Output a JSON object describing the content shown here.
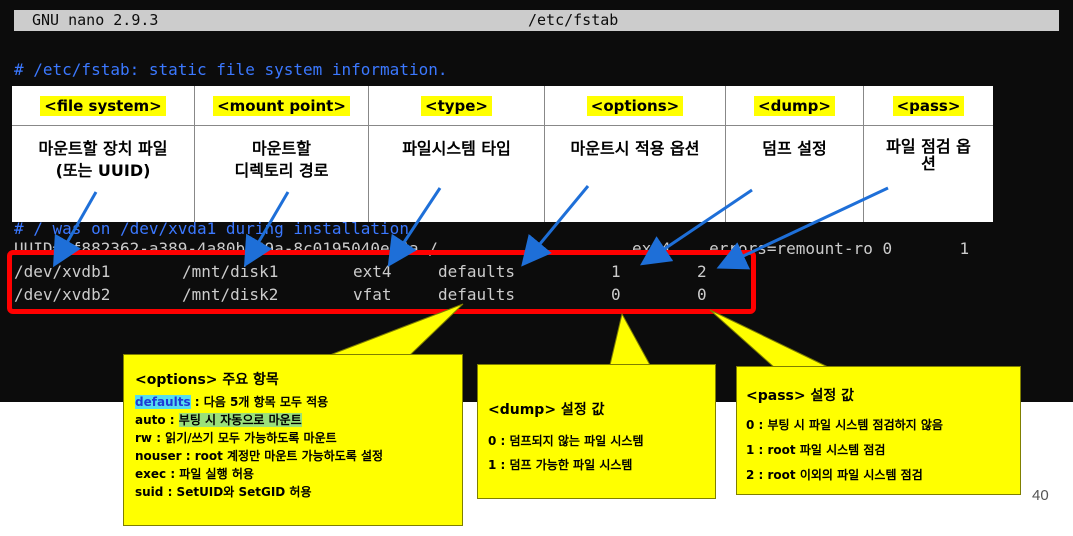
{
  "titlebar": {
    "app": "GNU nano 2.9.3",
    "file": "/etc/fstab"
  },
  "comment_line": "# /etc/fstab: static file system information.",
  "hidden_comment": "# / was on /dev/xvda1 during installation",
  "uuid_line": "UUID=8f882362-a389-4a80bb69a-8c0195040e44a /",
  "uuid_line_tail": "ext4    errors=remount-ro 0       1",
  "rows": [
    {
      "device": "/dev/xvdb1",
      "mount": "/mnt/disk1",
      "type": "ext4",
      "options": "defaults",
      "dump": "1",
      "pass": "2"
    },
    {
      "device": "/dev/xvdb2",
      "mount": "/mnt/disk2",
      "type": "vfat",
      "options": "defaults",
      "dump": "0",
      "pass": "0"
    }
  ],
  "table": {
    "headers": [
      "<file system>",
      "<mount point>",
      "<type>",
      "<options>",
      "<dump>",
      "<pass>"
    ],
    "desc": [
      [
        "마운트할 장치 파일",
        "(또는 UUID)"
      ],
      [
        "마운트할",
        "디렉토리 경로"
      ],
      [
        "파일시스템 타입"
      ],
      [
        "마운트시 적용 옵션"
      ],
      [
        "덤프 설정"
      ],
      [
        "파일 점검 옵",
        "션"
      ]
    ]
  },
  "callout_options": {
    "title": "<options> 주요 항목",
    "lines": [
      {
        "key": "defaults",
        "sep": " : ",
        "text": "다음 5개 항목 모두 적용"
      },
      {
        "key": "auto",
        "sep": " : ",
        "text": "부팅 시 자동으로 마운트"
      },
      {
        "key": "rw",
        "sep": " : ",
        "text": "읽기/쓰기 모두 가능하도록 마운트"
      },
      {
        "key": "nouser",
        "sep": " : ",
        "text": "root 계정만 마운트 가능하도록 설정"
      },
      {
        "key": "exec",
        "sep": " : ",
        "text": "파일 실행 허용"
      },
      {
        "key": "suid",
        "sep": " : ",
        "text": "SetUID와 SetGID 허용"
      }
    ]
  },
  "callout_dump": {
    "title": "<dump> 설정 값",
    "lines": [
      "0 : 덤프되지 않는 파일 시스템",
      "1 : 덤프 가능한 파일 시스템"
    ]
  },
  "callout_pass": {
    "title": "<pass> 설정 값",
    "lines": [
      "0 : 부팅 시 파일 시스템 점검하지 않음",
      "1 : root 파일 시스템 점검",
      "2 : root 이외의 파일 시스템 점검"
    ]
  },
  "page_number": "40",
  "colors": {
    "terminal_bg": "#0c0c0c",
    "comment": "#3b78ff",
    "highlight_box": "#ff0000",
    "callout": "#ffff00",
    "arrow": "#1e6fd8"
  }
}
